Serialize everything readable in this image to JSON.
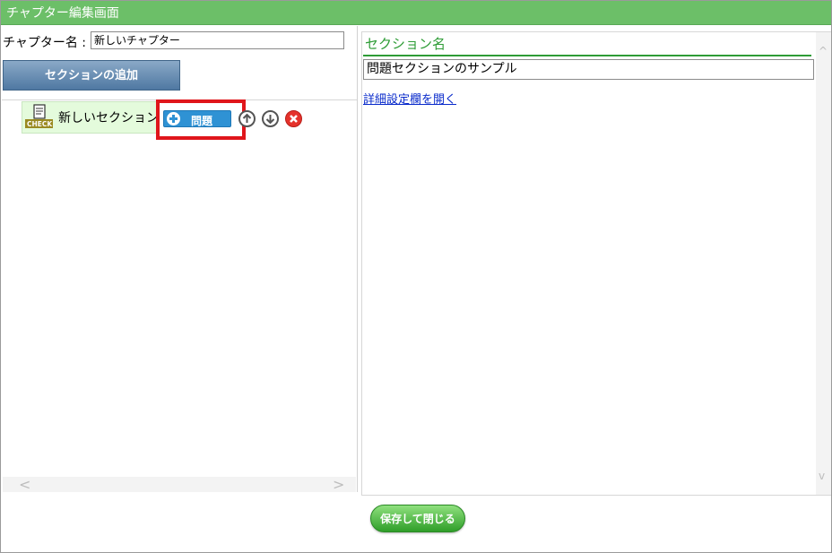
{
  "window": {
    "title": "チャプター編集画面"
  },
  "left": {
    "chapter_name_label": "チャプター名 :",
    "chapter_name_value": "新しいチャプター",
    "add_section_label": "セクションの追加",
    "section": {
      "name": "新しいセクション",
      "icon_text": "CHECK",
      "add_question_label": "問題"
    },
    "scroll_left": "<",
    "scroll_right": ">"
  },
  "right": {
    "section_name_heading": "セクション名",
    "section_name_value": "問題セクションのサンプル",
    "detail_link": "詳細設定欄を開く",
    "scroll_up": "^",
    "scroll_down": "v"
  },
  "footer": {
    "save_label": "保存して閉じる"
  },
  "colors": {
    "titlebar": "#6cbf68",
    "accent_green": "#2e9c36",
    "question_button": "#2f92d4",
    "highlight_red": "#e0161b",
    "link": "#0a2bcb"
  }
}
